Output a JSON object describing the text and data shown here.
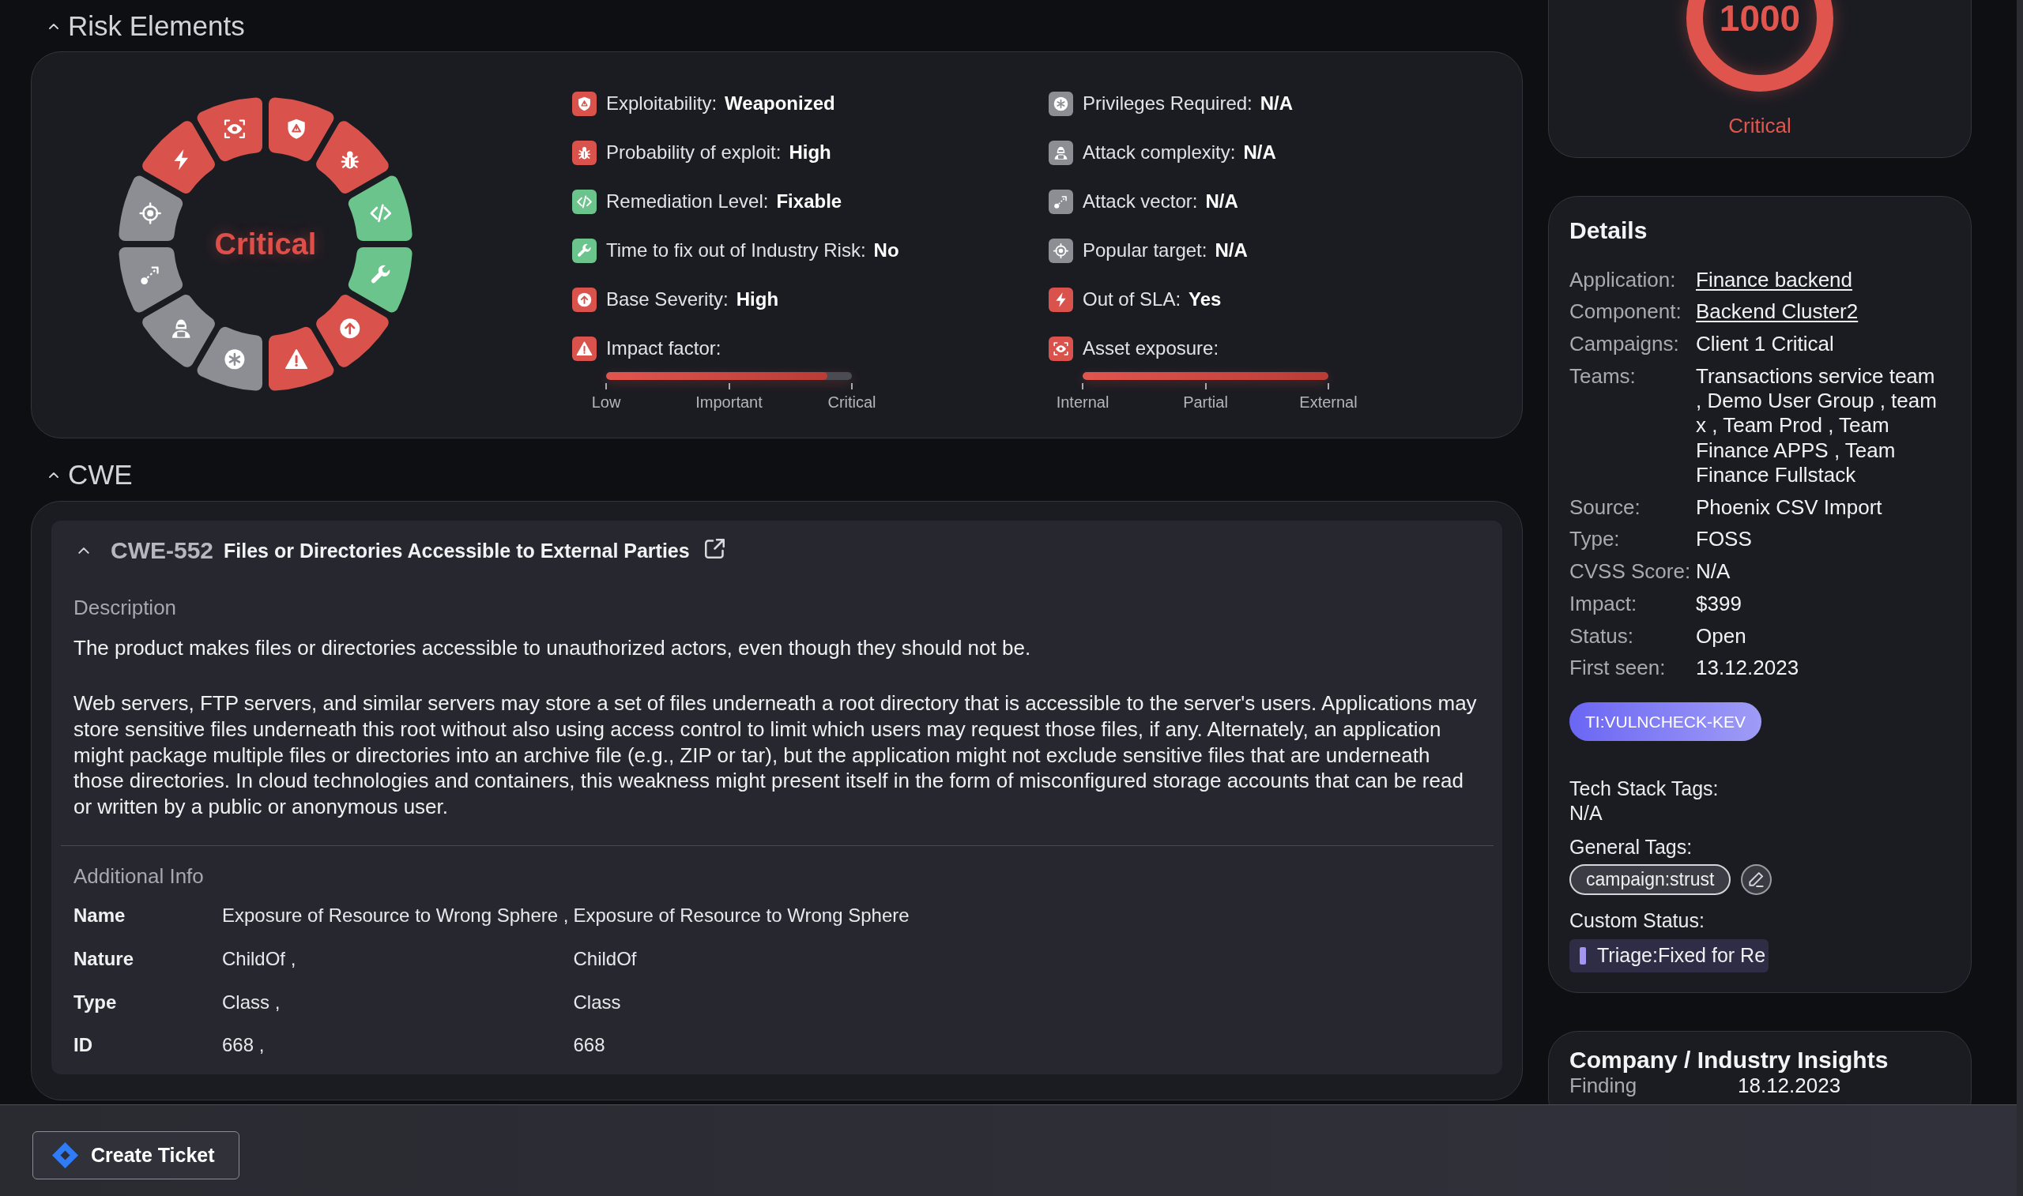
{
  "risk_elements": {
    "title": "Risk Elements",
    "expanded": true,
    "rating": "Critical",
    "metrics": [
      {
        "kind": "value",
        "label": "Exploitability:",
        "value": "Weaponized",
        "color": "#d9534c"
      },
      {
        "kind": "value",
        "label": "Probability of exploit:",
        "value": "High",
        "color": "#d9534c"
      },
      {
        "kind": "value",
        "label": "Remediation Level:",
        "value": "Fixable",
        "color": "#6bc48b"
      },
      {
        "kind": "value",
        "label": "Time to fix out of Industry Risk:",
        "value": "No",
        "color": "#6bc48b"
      },
      {
        "kind": "value",
        "label": "Base Severity:",
        "value": "High",
        "color": "#d9534c"
      },
      {
        "kind": "scale",
        "label": "Impact factor:",
        "level": 0.9,
        "ticks": [
          "Low",
          "Important",
          "Critical"
        ],
        "color": "#d9534c"
      },
      {
        "kind": "value",
        "label": "Privileges Required:",
        "value": "N/A",
        "color": "#8d8e94"
      },
      {
        "kind": "value",
        "label": "Attack complexity:",
        "value": "N/A",
        "color": "#8d8e94"
      },
      {
        "kind": "value",
        "label": "Attack vector:",
        "value": "N/A",
        "color": "#8d8e94"
      },
      {
        "kind": "value",
        "label": "Popular target:",
        "value": "N/A",
        "color": "#8d8e94"
      },
      {
        "kind": "value",
        "label": "Out of SLA:",
        "value": "Yes",
        "color": "#d9534c"
      },
      {
        "kind": "scale",
        "label": "Asset exposure:",
        "level": 1.0,
        "ticks": [
          "Internal",
          "Partial",
          "External"
        ],
        "color": "#d9534c"
      }
    ]
  },
  "cwe": {
    "title": "CWE",
    "expanded": true,
    "entries": [
      {
        "id": "CWE-552",
        "name": "Files or Directories Accessible to External Parties",
        "expanded": true,
        "description_title": "Description",
        "description": [
          "The product makes files or directories accessible to unauthorized actors, even though they should not be.",
          "Web servers, FTP servers, and similar servers may store a set of files underneath a root directory that is accessible to the server's users. Applications may store sensitive files underneath this root without also using access control to limit which users may request those files, if any. Alternately, an application might package multiple files or directories into an archive file (e.g., ZIP or tar), but the application might not exclude sensitive files that are underneath those directories. In cloud technologies and containers, this weakness might present itself in the form of misconfigured storage accounts that can be read or written by a public or anonymous user."
        ],
        "additional_title": "Additional Info",
        "additional_info": [
          {
            "label": "Name",
            "values": [
              "Exposure of Resource to Wrong Sphere ,",
              "Exposure of Resource to Wrong Sphere"
            ]
          },
          {
            "label": "Nature",
            "values": [
              "ChildOf ,",
              "ChildOf"
            ]
          },
          {
            "label": "Type",
            "values": [
              "Class ,",
              "Class"
            ]
          },
          {
            "label": "ID",
            "values": [
              "668 ,",
              "668"
            ]
          }
        ]
      }
    ]
  },
  "score": {
    "value": "1000",
    "rating": "Critical"
  },
  "details": {
    "title": "Details",
    "fields": [
      {
        "label": "Application:",
        "value": "Finance backend",
        "link": true
      },
      {
        "label": "Component:",
        "value": "Backend Cluster2",
        "link": true
      },
      {
        "label": "Campaigns:",
        "value": "Client 1 Critical",
        "link": false
      },
      {
        "label": "Teams:",
        "value": "Transactions service team , Demo User Group , team x , Team Prod , Team Finance APPS , Team Finance Fullstack",
        "link": false
      },
      {
        "label": "Source:",
        "value": "Phoenix CSV Import",
        "link": false
      },
      {
        "label": "Type:",
        "value": "FOSS",
        "link": false
      },
      {
        "label": "CVSS Score:",
        "value": "N/A",
        "link": false
      },
      {
        "label": "Impact:",
        "value": "$399",
        "link": false
      },
      {
        "label": "Status:",
        "value": "Open",
        "link": false
      },
      {
        "label": "First seen:",
        "value": "13.12.2023",
        "link": false
      }
    ],
    "ti_tags": [
      "TI:VULNCHECK-KEV"
    ],
    "tech_stack": {
      "label": "Tech Stack Tags:",
      "value": "N/A"
    },
    "general_tags": {
      "label": "General Tags:",
      "tags": [
        "campaign:strust"
      ]
    },
    "custom_status": {
      "label": "Custom Status:",
      "value": "Triage:Fixed for Re"
    }
  },
  "insights": {
    "title": "Company / Industry Insights",
    "fields": [
      {
        "label": "Finding",
        "value": "18.12.2023"
      }
    ]
  },
  "footer": {
    "create_ticket": "Create Ticket"
  }
}
